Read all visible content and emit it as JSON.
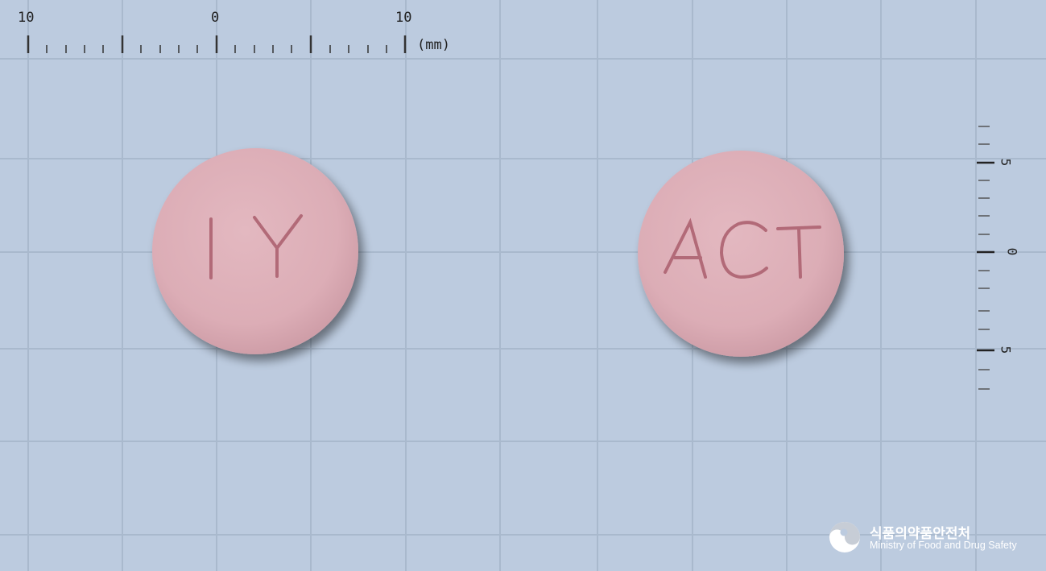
{
  "ruler": {
    "h_labels": [
      "10",
      "0",
      "10"
    ],
    "unit": "(mm)",
    "v_labels": [
      "5",
      "0",
      "5"
    ]
  },
  "pills": [
    {
      "imprint": "I Y",
      "color": "#dfb0b8"
    },
    {
      "imprint": "ACT",
      "color": "#dfb0b8"
    }
  ],
  "logo": {
    "korean": "식품의약품안전처",
    "english": "Ministry of Food and Drug Safety"
  },
  "colors": {
    "background": "#bccbdf",
    "grid": "#a9b9cd",
    "pill": "#dfb0b8",
    "imprint": "#b26a78"
  }
}
